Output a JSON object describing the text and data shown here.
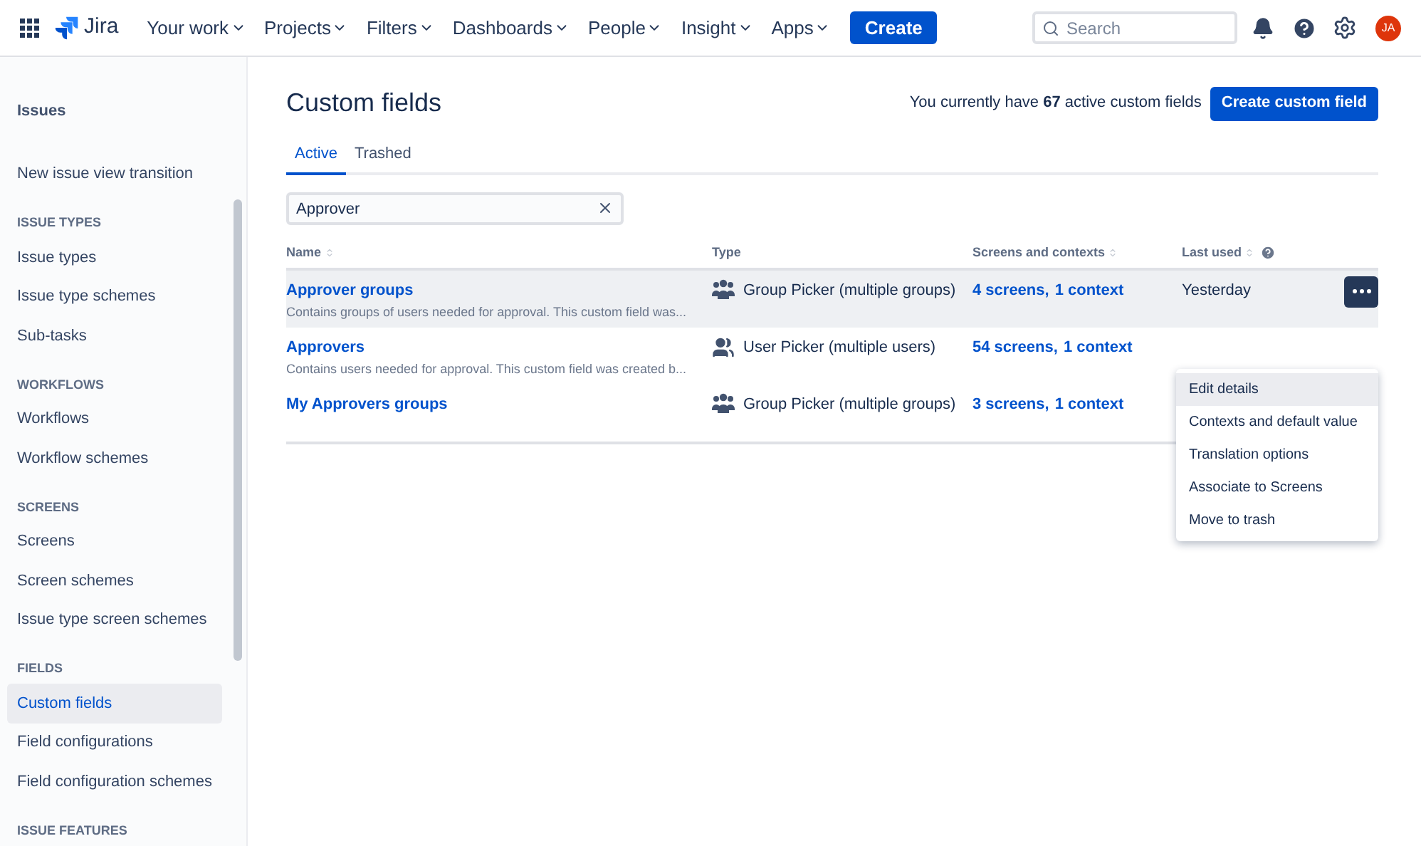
{
  "topbar": {
    "product": "Jira",
    "nav": [
      {
        "label": "Your work"
      },
      {
        "label": "Projects"
      },
      {
        "label": "Filters"
      },
      {
        "label": "Dashboards"
      },
      {
        "label": "People"
      },
      {
        "label": "Insight"
      },
      {
        "label": "Apps"
      }
    ],
    "create": "Create",
    "search": {
      "placeholder": "Search"
    },
    "avatar": "JA"
  },
  "sidebar": {
    "title": "Issues",
    "items": [
      {
        "kind": "link",
        "label": "New issue view transition",
        "selected": false
      },
      {
        "kind": "heading",
        "label": "ISSUE TYPES"
      },
      {
        "kind": "link",
        "label": "Issue types",
        "selected": false
      },
      {
        "kind": "link",
        "label": "Issue type schemes",
        "selected": false
      },
      {
        "kind": "link",
        "label": "Sub-tasks",
        "selected": false
      },
      {
        "kind": "heading",
        "label": "WORKFLOWS"
      },
      {
        "kind": "link",
        "label": "Workflows",
        "selected": false
      },
      {
        "kind": "link",
        "label": "Workflow schemes",
        "selected": false
      },
      {
        "kind": "heading",
        "label": "SCREENS"
      },
      {
        "kind": "link",
        "label": "Screens",
        "selected": false
      },
      {
        "kind": "link",
        "label": "Screen schemes",
        "selected": false
      },
      {
        "kind": "link",
        "label": "Issue type screen schemes",
        "selected": false
      },
      {
        "kind": "heading",
        "label": "FIELDS"
      },
      {
        "kind": "link",
        "label": "Custom fields",
        "selected": true
      },
      {
        "kind": "link",
        "label": "Field configurations",
        "selected": false
      },
      {
        "kind": "link",
        "label": "Field configuration schemes",
        "selected": false
      },
      {
        "kind": "heading",
        "label": "ISSUE FEATURES"
      }
    ]
  },
  "page": {
    "title": "Custom fields",
    "count_text": "You currently have **67** active custom fields",
    "create_button": "Create custom field",
    "tabs": [
      {
        "label": "Active",
        "selected": true
      },
      {
        "label": "Trashed",
        "selected": false
      }
    ],
    "filter": {
      "value": "Approver"
    },
    "table": {
      "columns": [
        {
          "label": "Name",
          "sortable": true
        },
        {
          "label": "Type",
          "sortable": false
        },
        {
          "label": "Screens and contexts",
          "sortable": true
        },
        {
          "label": "Last used",
          "sortable": true,
          "help": true
        }
      ],
      "rows": [
        {
          "name": "Approver groups",
          "description": "Contains groups of users needed for approval. This custom field was...",
          "kind": "group",
          "type": "Group Picker (multiple groups)",
          "screens": "4 screens,",
          "contexts": "1 context",
          "last_used": "Yesterday",
          "highlighted": true,
          "actions": true
        },
        {
          "name": "Approvers",
          "description": "Contains users needed for approval. This custom field was created b...",
          "kind": "user",
          "type": "User Picker (multiple users)",
          "screens": "54 screens,",
          "contexts": "1 context",
          "highlighted": false,
          "actions": false
        },
        {
          "name": "My Approvers groups",
          "kind": "group",
          "type": "Group Picker (multiple groups)",
          "screens": "3 screens,",
          "contexts": "1 context",
          "highlighted": false,
          "actions": false
        }
      ]
    },
    "menu": {
      "items": [
        {
          "label": "Edit details",
          "selected": true
        },
        {
          "label": "Contexts and default value",
          "selected": false
        },
        {
          "label": "Translation options",
          "selected": false
        },
        {
          "label": "Associate to Screens",
          "selected": false
        },
        {
          "label": "Move to trash",
          "selected": false
        }
      ]
    }
  }
}
